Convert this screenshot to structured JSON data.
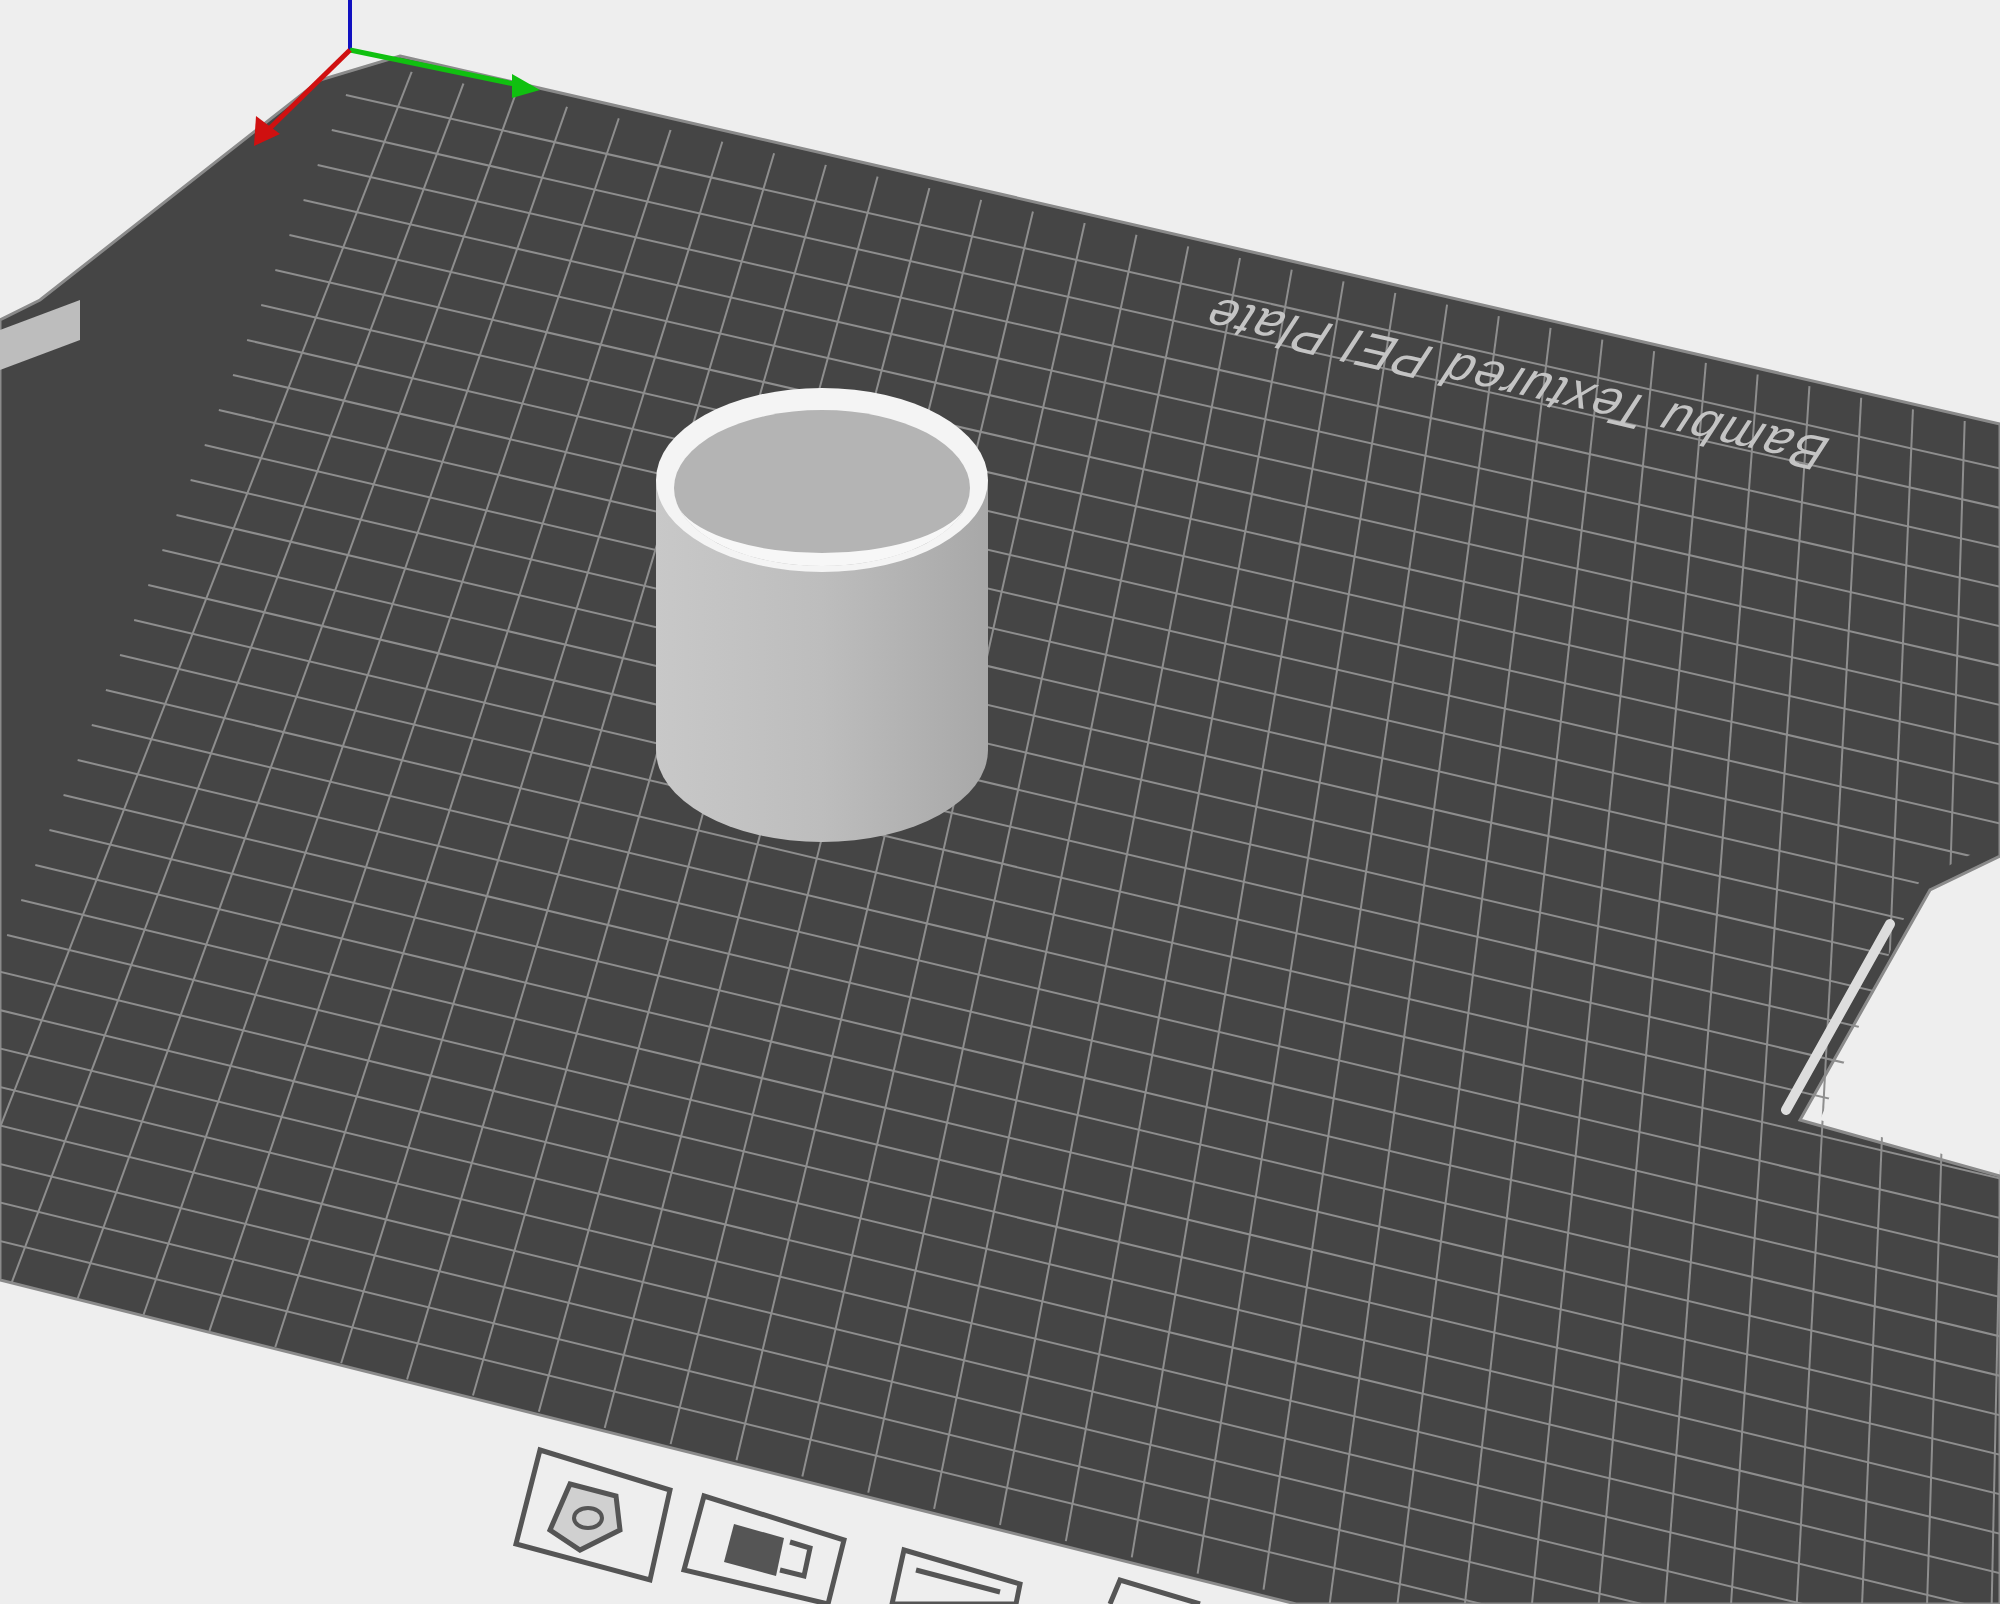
{
  "plate": {
    "label": "Bambu Textured PEI Plate"
  }
}
